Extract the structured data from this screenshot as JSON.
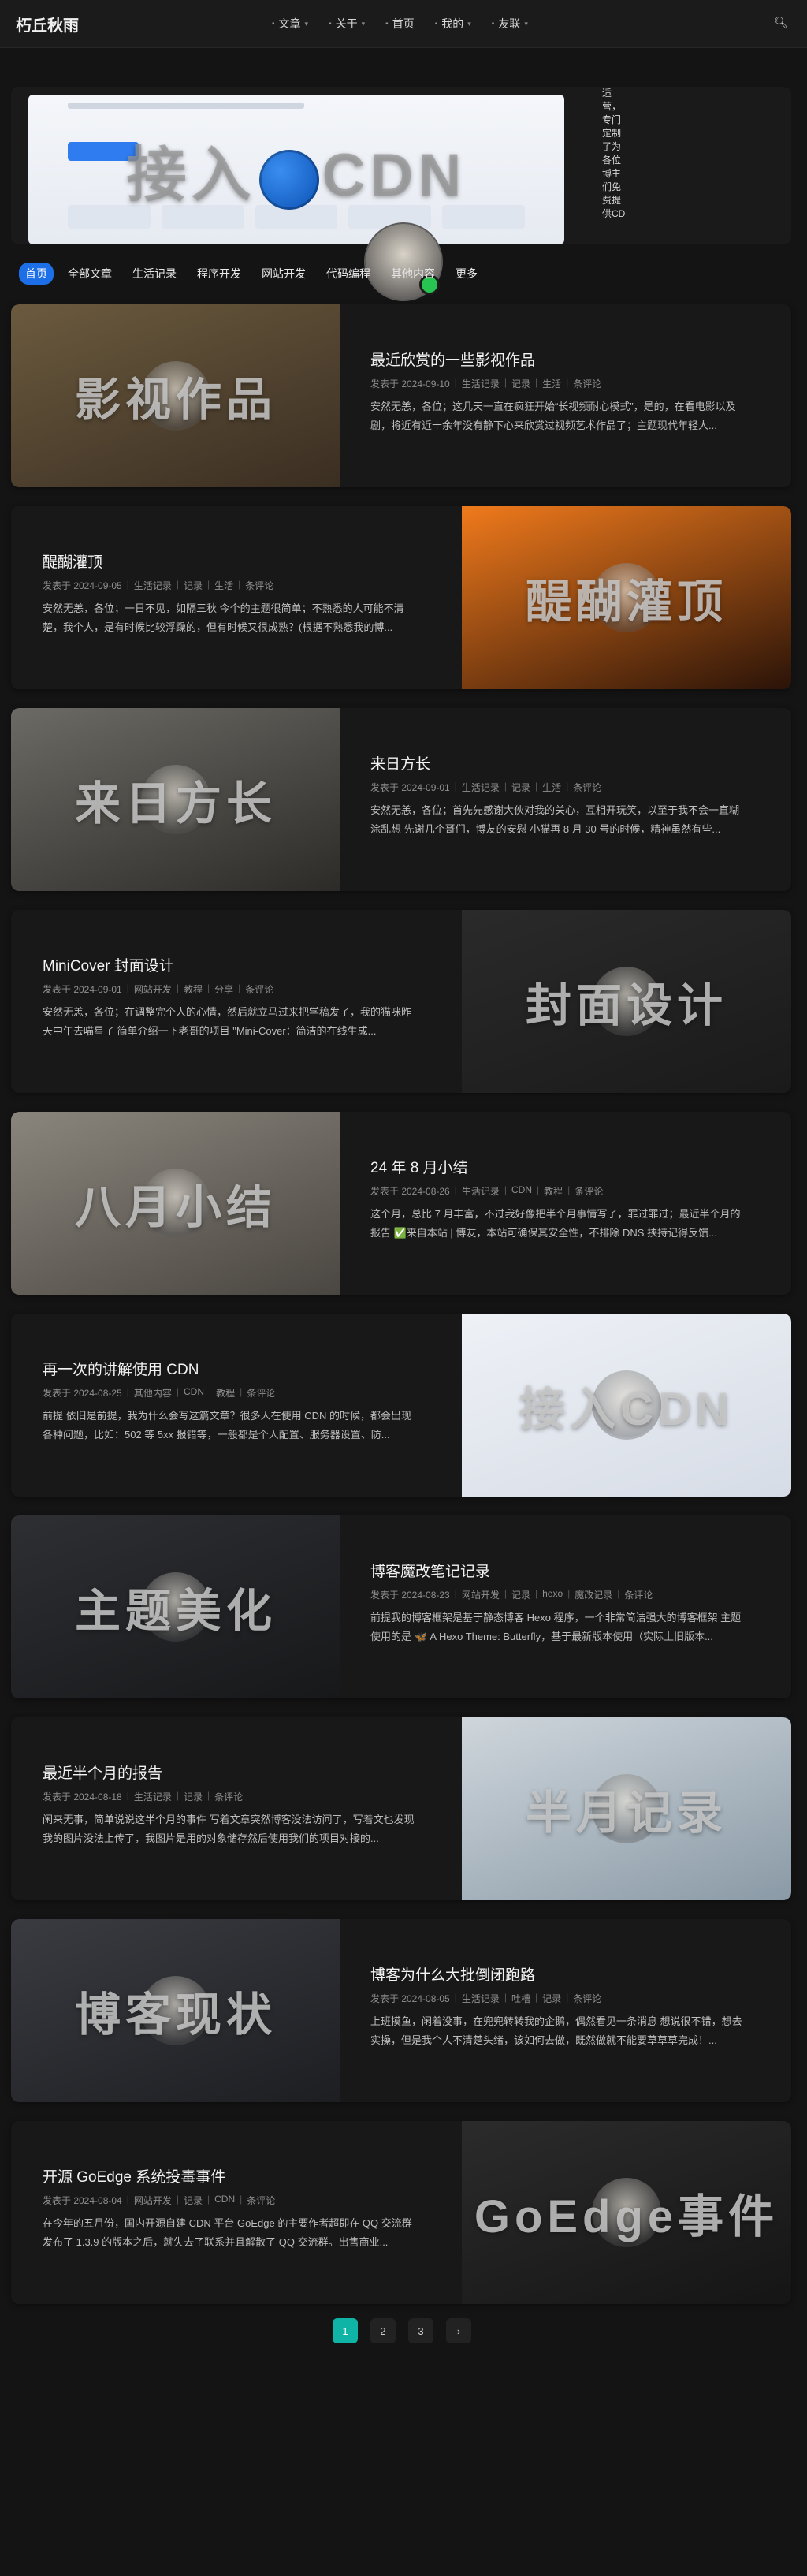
{
  "site": {
    "title": "朽丘秋雨"
  },
  "nav": {
    "items": [
      {
        "label": "文章",
        "has_dropdown": true
      },
      {
        "label": "关于",
        "has_dropdown": true
      },
      {
        "label": "首页",
        "has_dropdown": false
      },
      {
        "label": "我的",
        "has_dropdown": true
      },
      {
        "label": "友联",
        "has_dropdown": true
      }
    ],
    "search_icon": "search-icon"
  },
  "featured": {
    "cover_text_left": "接入",
    "cover_text_right": "CDN",
    "side_text": "适营，专门定制了为各位博主们免费提供CD"
  },
  "tabs": [
    "首页",
    "全部文章",
    "生活记录",
    "程序开发",
    "网站开发",
    "代码编程",
    "其他内容",
    "更多"
  ],
  "posts": [
    {
      "title": "最近欣赏的一些影视作品",
      "meta": [
        "发表于 2024-09-10",
        "生活记录",
        "记录",
        "生活",
        "条评论"
      ],
      "excerpt": "安然无恙，各位；这几天一直在疯狂开始“长视频耐心模式”，是的，在看电影以及剧，将近有近十余年没有静下心来欣赏过视频艺术作品了；主题现代年轻人...",
      "cover_text": "影视作品",
      "cover_side": "left",
      "cover_colors": [
        "#6b5a3e",
        "#3a2e22"
      ]
    },
    {
      "title": "醍醐灌顶",
      "meta": [
        "发表于 2024-09-05",
        "生活记录",
        "记录",
        "生活",
        "条评论"
      ],
      "excerpt": "安然无恙，各位；一日不见，如隔三秋 今个的主题很简单；不熟悉的人可能不清楚，我个人，是有时候比较浮躁的，但有时候又很成熟？(根据不熟悉我的博...",
      "cover_text": "醍醐灌顶",
      "cover_side": "right",
      "cover_colors": [
        "#f07a1c",
        "#2a1308"
      ]
    },
    {
      "title": "来日方长",
      "meta": [
        "发表于 2024-09-01",
        "生活记录",
        "记录",
        "生活",
        "条评论"
      ],
      "excerpt": "安然无恙，各位；首先先感谢大伙对我的关心，互相开玩笑，以至于我不会一直糊涂乱想 先谢几个哥们，博友的安慰 小猫再 8 月 30 号的时候，精神虽然有些...",
      "cover_text": "来日方长",
      "cover_side": "left",
      "cover_colors": [
        "#6c6a64",
        "#2d2b28"
      ]
    },
    {
      "title": "MiniCover 封面设计",
      "meta": [
        "发表于 2024-09-01",
        "网站开发",
        "教程",
        "分享",
        "条评论"
      ],
      "excerpt": "安然无恙，各位；在调整完个人的心情，然后就立马过来把学稿发了，我的猫咪昨天中午去喵星了 简单介绍一下老哥的项目 \"Mini-Cover：简洁的在线生成...",
      "cover_text": "封面设计",
      "cover_side": "right",
      "cover_colors": [
        "#2a2a2a",
        "#1a1a1a"
      ]
    },
    {
      "title": "24 年 8 月小结",
      "meta": [
        "发表于 2024-08-26",
        "生活记录",
        "CDN",
        "教程",
        "条评论"
      ],
      "excerpt": "这个月，总比 7 月丰富，不过我好像把半个月事情写了，罪过罪过；最近半个月的报告 ✅来自本站 | 博友，本站可确保其安全性，不排除 DNS 挟持记得反馈...",
      "cover_text": "八月小结",
      "cover_side": "left",
      "cover_colors": [
        "#8a857c",
        "#4a4641"
      ]
    },
    {
      "title": "再一次的讲解使用 CDN",
      "meta": [
        "发表于 2024-08-25",
        "其他内容",
        "CDN",
        "教程",
        "条评论"
      ],
      "excerpt": "前提 依旧是前提，我为什么会写这篇文章？很多人在使用 CDN 的时候，都会出现各种问题，比如：502 等 5xx 报错等，一般都是个人配置、服务器设置、防...",
      "cover_text": "接入CDN",
      "cover_side": "right",
      "cover_colors": [
        "#eef1f6",
        "#d6dce6"
      ]
    },
    {
      "title": "博客魔改笔记记录",
      "meta": [
        "发表于 2024-08-23",
        "网站开发",
        "记录",
        "hexo",
        "魔改记录",
        "条评论"
      ],
      "excerpt": "前提我的博客框架是基于静态博客 Hexo 程序，一个非常简洁强大的博客框架 主题使用的是 🦋 A Hexo Theme: Butterfly，基于最新版本使用（实际上旧版本...",
      "cover_text": "主题美化",
      "cover_side": "left",
      "cover_colors": [
        "#2e2f33",
        "#17181a"
      ]
    },
    {
      "title": "最近半个月的报告",
      "meta": [
        "发表于 2024-08-18",
        "生活记录",
        "记录",
        "条评论"
      ],
      "excerpt": "闲来无事，简单说说这半个月的事件 写着文章突然博客没法访问了，写着文也发现我的图片没法上传了，我图片是用的对象储存然后使用我们的项目对接的...",
      "cover_text": "半月记录",
      "cover_side": "right",
      "cover_colors": [
        "#cfd6dc",
        "#8a9aa6"
      ]
    },
    {
      "title": "博客为什么大批倒闭跑路",
      "meta": [
        "发表于 2024-08-05",
        "生活记录",
        "吐槽",
        "记录",
        "条评论"
      ],
      "excerpt": "上班摸鱼，闲着没事，在兜兜转转我的企鹅，偶然看见一条消息 想说很不错，想去实操，但是我个人不清楚头绪，该如何去做，既然做就不能要草草草完成！...",
      "cover_text": "博客现状",
      "cover_side": "left",
      "cover_colors": [
        "#3a3b40",
        "#1d1e22"
      ]
    },
    {
      "title": "开源 GoEdge 系统投毒事件",
      "meta": [
        "发表于 2024-08-04",
        "网站开发",
        "记录",
        "CDN",
        "条评论"
      ],
      "excerpt": "在今年的五月份，国内开源自建 CDN 平台 GoEdge 的主要作者超即在 QQ 交流群发布了 1.3.9 的版本之后，就失去了联系并且解散了 QQ 交流群。出售商业...",
      "cover_text": "GoEdge事件",
      "cover_side": "right",
      "cover_colors": [
        "#2b2b2b",
        "#151515"
      ]
    }
  ],
  "pagination": {
    "pages": [
      "1",
      "2",
      "3"
    ],
    "current": "1",
    "next": "›"
  }
}
